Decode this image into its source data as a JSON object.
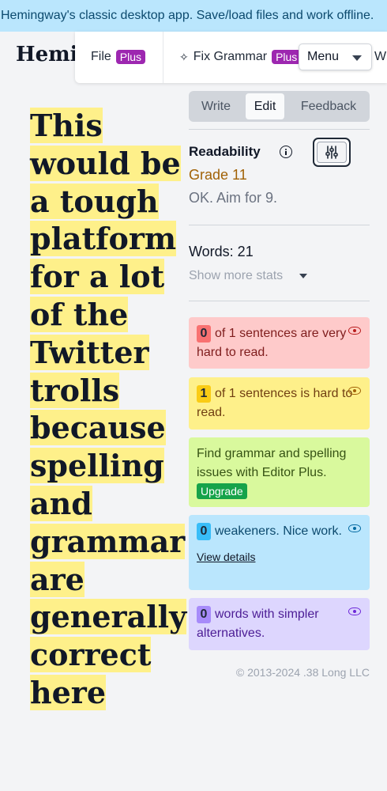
{
  "banner": {
    "text": "Hemingway's classic desktop app. Save/load files and work offline."
  },
  "logo": {
    "text": "Hemingway"
  },
  "toolbar": {
    "file_label": "File",
    "file_badge": "Plus",
    "fix_label": "Fix Grammar",
    "fix_badge": "Plus",
    "menu_label": "Menu",
    "write_label": "Write"
  },
  "editor": {
    "text": "This would be a tough platform for a lot of the Twitter trolls because spelling and grammar are generally correct here",
    "highlight_color": "#fef08a"
  },
  "tabs": [
    {
      "label": "Write",
      "active": false
    },
    {
      "label": "Edit",
      "active": true
    },
    {
      "label": "Feedback",
      "active": false
    }
  ],
  "readability": {
    "title": "Readability",
    "grade": "Grade 11",
    "note": "OK. Aim for 9."
  },
  "stats": {
    "words": "Words: 21",
    "more": "Show more stats"
  },
  "cards": {
    "very_hard": {
      "count": "0",
      "text": "of 1 sentences are very hard to read."
    },
    "hard": {
      "count": "1",
      "text": "of 1 sentences is hard to read."
    },
    "grammar": {
      "text": "Find grammar and spelling issues with Editor Plus.",
      "button": "Upgrade"
    },
    "weakeners": {
      "count": "0",
      "text": "weakeners. Nice work.",
      "link": "View details"
    },
    "simpler": {
      "count": "0",
      "text": "words with simpler alternatives."
    }
  },
  "footer": {
    "copyright": "© 2013-2024 .38 Long LLC"
  },
  "colors": {
    "very_hard": "#fecaca",
    "hard": "#fef08a",
    "grammar": "#d9f99d",
    "weakeners": "#bae6fd",
    "simpler": "#ddd6fe",
    "grade": "#a16207",
    "plus_badge": "#9d27b0",
    "upgrade_button": "#16a34a"
  }
}
